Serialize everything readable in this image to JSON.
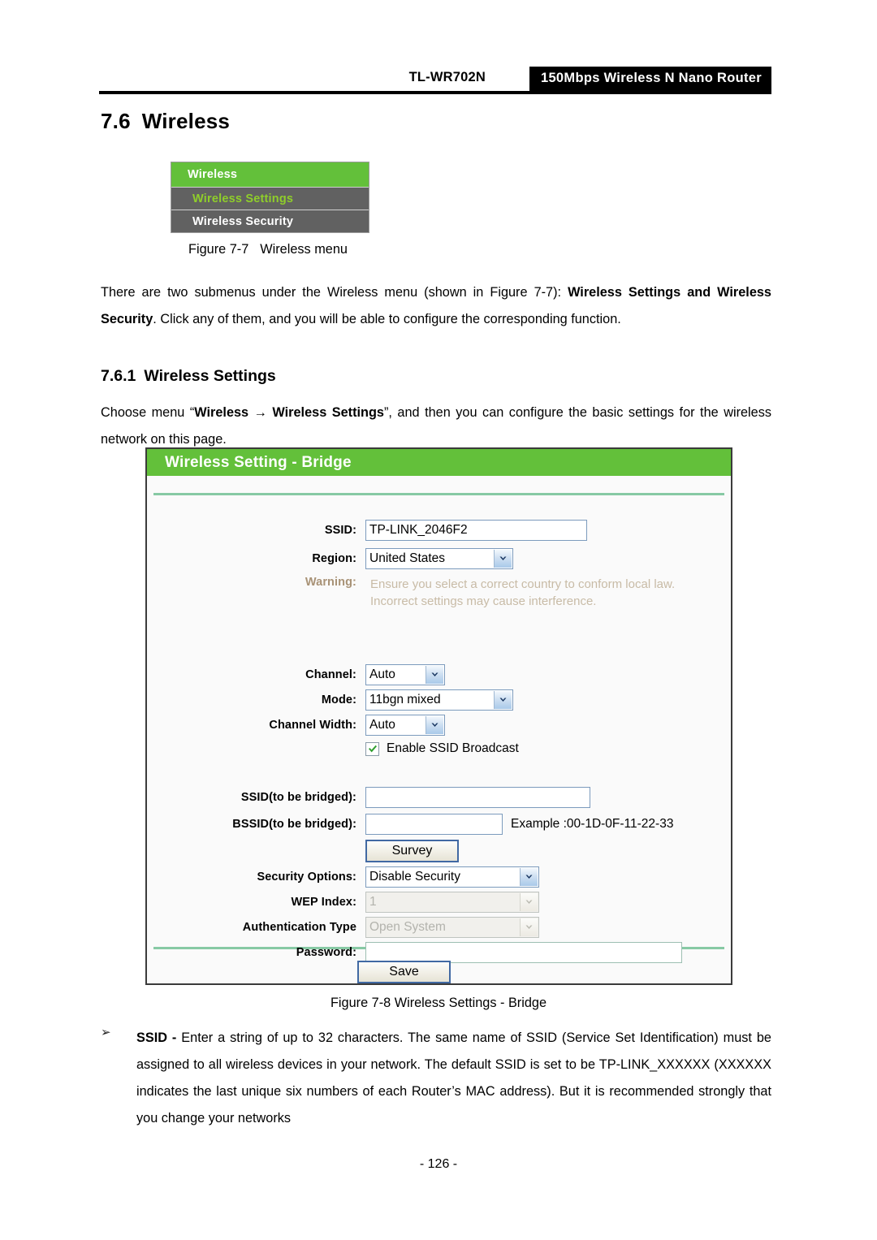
{
  "header": {
    "model": "TL-WR702N",
    "product_band": "150Mbps  Wireless  N  Nano  Router"
  },
  "section": {
    "number": "7.6",
    "title": "Wireless"
  },
  "wireless_menu": {
    "header_label": "Wireless",
    "items": [
      {
        "label": "Wireless Settings",
        "active": true
      },
      {
        "label": "Wireless Security",
        "active": false
      }
    ]
  },
  "figures": {
    "fig_7_7_label": "Figure 7-7",
    "fig_7_7_title": "Wireless menu",
    "fig_7_8_caption": "Figure 7-8 Wireless Settings - Bridge"
  },
  "paragraphs": {
    "intro_1": "There are two submenus under the Wireless menu (shown in Figure 7-7): ",
    "intro_bold_1": "Wireless Settings and Wireless Security",
    "intro_2": ". Click any of them, and you will be able to configure the corresponding function.",
    "choose_1": "Choose menu “",
    "choose_bold_1": "Wireless",
    "choose_arrow": "→",
    "choose_bold_2": "Wireless Settings",
    "choose_2": "”, and then you can configure the basic settings for the wireless network on this page."
  },
  "subsection": {
    "number": "7.6.1",
    "title": "Wireless Settings"
  },
  "router_panel": {
    "title": "Wireless Setting - Bridge",
    "fields": {
      "ssid_label": "SSID:",
      "ssid_value": "TP-LINK_2046F2",
      "region_label": "Region:",
      "region_value": "United States",
      "warning_label": "Warning:",
      "warning_line1": "Ensure you select a correct country to conform local law.",
      "warning_line2": "Incorrect settings may cause interference.",
      "channel_label": "Channel:",
      "channel_value": "Auto",
      "mode_label": "Mode:",
      "mode_value": "11bgn mixed",
      "channel_width_label": "Channel Width:",
      "channel_width_value": "Auto",
      "ssid_broadcast_label": "Enable SSID Broadcast",
      "ssid_broadcast_checked": true,
      "ssid_bridged_label": "SSID(to be bridged):",
      "ssid_bridged_value": "",
      "bssid_bridged_label": "BSSID(to be bridged):",
      "bssid_bridged_value": "",
      "bssid_example": "Example :00-1D-0F-11-22-33",
      "survey_button": "Survey",
      "security_options_label": "Security Options:",
      "security_options_value": "Disable Security",
      "wep_index_label": "WEP Index:",
      "wep_index_value": "1",
      "auth_type_label": "Authentication Type",
      "auth_type_value": "Open System",
      "password_label": "Password:",
      "password_value": "",
      "save_button": "Save"
    }
  },
  "bullets": [
    {
      "marker": "➢",
      "term": "SSID - ",
      "text": "Enter a string of up to 32 characters. The same name of SSID (Service Set Identification) must be assigned to all wireless devices in your network. The default SSID is set to be TP-LINK_XXXXXX (XXXXXX indicates the last unique six numbers of each Router’s MAC address). But it is recommended strongly that you change your networks"
    }
  ],
  "footer": {
    "page_number": "- 126 -"
  },
  "colors": {
    "brand_green": "#63c03a",
    "menu_gray": "#616161",
    "menu_active_text": "#8fce2a",
    "warning_text": "#a89276",
    "rule_green": "#87c9a4"
  }
}
